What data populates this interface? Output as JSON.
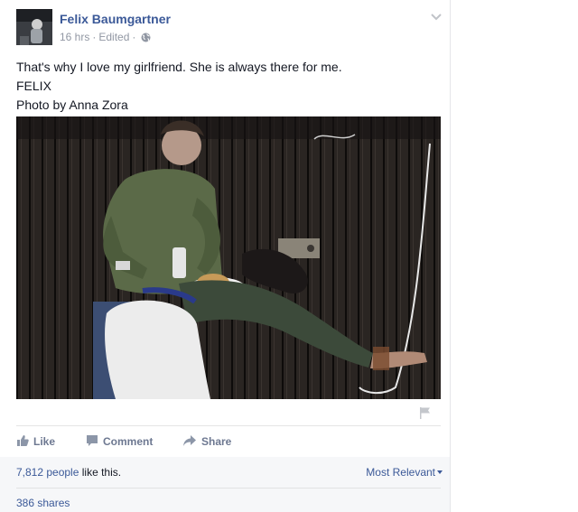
{
  "post": {
    "author": "Felix Baumgartner",
    "time": "16 hrs",
    "edited": "Edited",
    "separator": "·",
    "text_lines": [
      "That's why I love my girlfriend. She is always there for me.",
      "FELIX",
      "Photo by Anna Zora"
    ]
  },
  "actions": {
    "like": "Like",
    "comment": "Comment",
    "share": "Share"
  },
  "summary": {
    "likes_count": "7,812 people",
    "likes_suffix": " like this.",
    "sort_label": "Most Relevant",
    "shares": "386 shares"
  },
  "icons": {
    "avatar": "profile-photo",
    "audience": "globe-icon",
    "menu": "chevron-down-icon",
    "report": "flag-icon",
    "like": "thumbs-up-icon",
    "comment": "speech-bubble-icon",
    "share": "share-arrow-icon"
  },
  "colors": {
    "link": "#3b5998",
    "muted": "#9197a3",
    "action": "#6d7891",
    "summary_bg": "#f6f7f9"
  }
}
